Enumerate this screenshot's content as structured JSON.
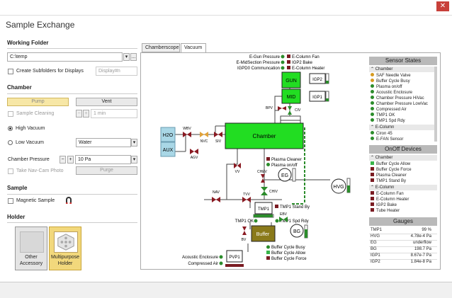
{
  "window": {
    "title": "Sample Exchange",
    "close": "✕"
  },
  "working_folder": {
    "heading": "Working Folder",
    "path": "C:\\temp",
    "dropdown_icon": "▾",
    "browse": "...",
    "create_subfolders": "Create Subfolders for Displays",
    "display_placeholder": "Display#n"
  },
  "chamber": {
    "heading": "Chamber",
    "pump": "Pump",
    "vent": "Vent",
    "sample_cleaning": "Sample Cleaning",
    "minus": "−",
    "plus": "+",
    "clean_time": "1 min",
    "high_vacuum": "High Vacuum",
    "low_vacuum": "Low Vacuum",
    "low_vac_gas": "Water",
    "pressure_label": "Chamber Pressure",
    "pressure_value": "10 Pa",
    "navcam": "Take Nav-Cam Photo",
    "purge": "Purge"
  },
  "sample": {
    "heading": "Sample",
    "magnetic": "Magnetic Sample"
  },
  "holder": {
    "heading": "Holder",
    "items": [
      {
        "line1": "Other",
        "line2": "Accessory",
        "selected": false
      },
      {
        "line1": "Multipurpose",
        "line2": "Holder",
        "selected": true
      }
    ]
  },
  "tabs": [
    "Chamberscope",
    "Vacuum"
  ],
  "diagram": {
    "top_labels": {
      "egun_pressure": "E-Gun Pressure",
      "emid_pressure": "E-MidSection Pressure",
      "igp_comm": "IGPD0 Communcation",
      "ecol_fan": "E-Column Fan",
      "igp2_bake": "IGP2 Bake",
      "ecol_heater": "E-Column Heater"
    },
    "gun": "GUN",
    "mid": "MID",
    "igp2": "IGP2",
    "igp1": "IGP1",
    "bpv": "BPV",
    "civ": "CIV",
    "h2o": "H2O",
    "aux": "AUX",
    "wbv": "WBV",
    "agv": "AGV",
    "nvc": "NVC",
    "siv": "SIV",
    "chamber": "Chamber",
    "vv": "VV",
    "plasma_cleaner": "Plasma Cleaner",
    "plasma_onoff": "Plasma on/off",
    "eg": "EG",
    "chev": "CHEV",
    "chiv": "CHIV",
    "hvg": "HVG",
    "nav": "NAV",
    "tvv": "TVV",
    "tmp1": "TMP1",
    "tmp1_standby": "TMP1 Stand By",
    "tmp1_ok": "TMP1 OK",
    "tmp1_spd": "TMP1 Spd Rdy",
    "ebv": "EBV",
    "bv": "BV",
    "buffer": "Buffer",
    "bg": "BG",
    "buffer_busy": "Buffer Cycle Busy",
    "buffer_allow": "Buffer Cycle Allow",
    "buffer_force": "Buffer Cycle Force",
    "pvp1": "PVP1",
    "acoustic": "Acoustic Enclosure",
    "compressed": "Compressed Air"
  },
  "sensor_states": {
    "title": "Sensor States",
    "groups": [
      {
        "name": "Chamber",
        "items": [
          {
            "label": "SAF Needle Valve",
            "state": "orange"
          },
          {
            "label": "Buffer Cycle Busy",
            "state": "orange"
          },
          {
            "label": "Plasma on/off",
            "state": "green"
          },
          {
            "label": "Acoustic Enclosure",
            "state": "green"
          },
          {
            "label": "Chamber Pressure HiVac",
            "state": "green"
          },
          {
            "label": "Chamber Pressure LowVac",
            "state": "green"
          },
          {
            "label": "Compressed Air",
            "state": "green"
          },
          {
            "label": "TMP1 OK",
            "state": "green"
          },
          {
            "label": "TMP1 Spd Rdy",
            "state": "green"
          }
        ]
      },
      {
        "name": "E-Column",
        "items": [
          {
            "label": "Ciron 45",
            "state": "green"
          },
          {
            "label": "E-FAN Sensor",
            "state": "green"
          }
        ]
      }
    ]
  },
  "onoff_devices": {
    "title": "OnOff Devices",
    "groups": [
      {
        "name": "Chamber",
        "items": [
          {
            "label": "Buffer Cycle Allow",
            "state": "on"
          },
          {
            "label": "Buffer Cycle Force",
            "state": "off"
          },
          {
            "label": "Plasma Cleaner",
            "state": "off"
          },
          {
            "label": "TMP1 Stand By",
            "state": "off"
          }
        ]
      },
      {
        "name": "E-Column",
        "items": [
          {
            "label": "E-Column Fan",
            "state": "off"
          },
          {
            "label": "E-Column Heater",
            "state": "off"
          },
          {
            "label": "IGP2 Bake",
            "state": "off"
          },
          {
            "label": "Tube Heater",
            "state": "off"
          }
        ]
      }
    ]
  },
  "gauges": {
    "title": "Gauges",
    "rows": [
      {
        "name": "TMP1",
        "value": "99 %"
      },
      {
        "name": "HVG",
        "value": "4.78e-4 Pa"
      },
      {
        "name": "EG",
        "value": "underflow"
      },
      {
        "name": "BG",
        "value": "198.7 Pa"
      },
      {
        "name": "IGP1",
        "value": "8.67e-7 Pa"
      },
      {
        "name": "IGP2",
        "value": "1.84e-8 Pa"
      }
    ]
  }
}
